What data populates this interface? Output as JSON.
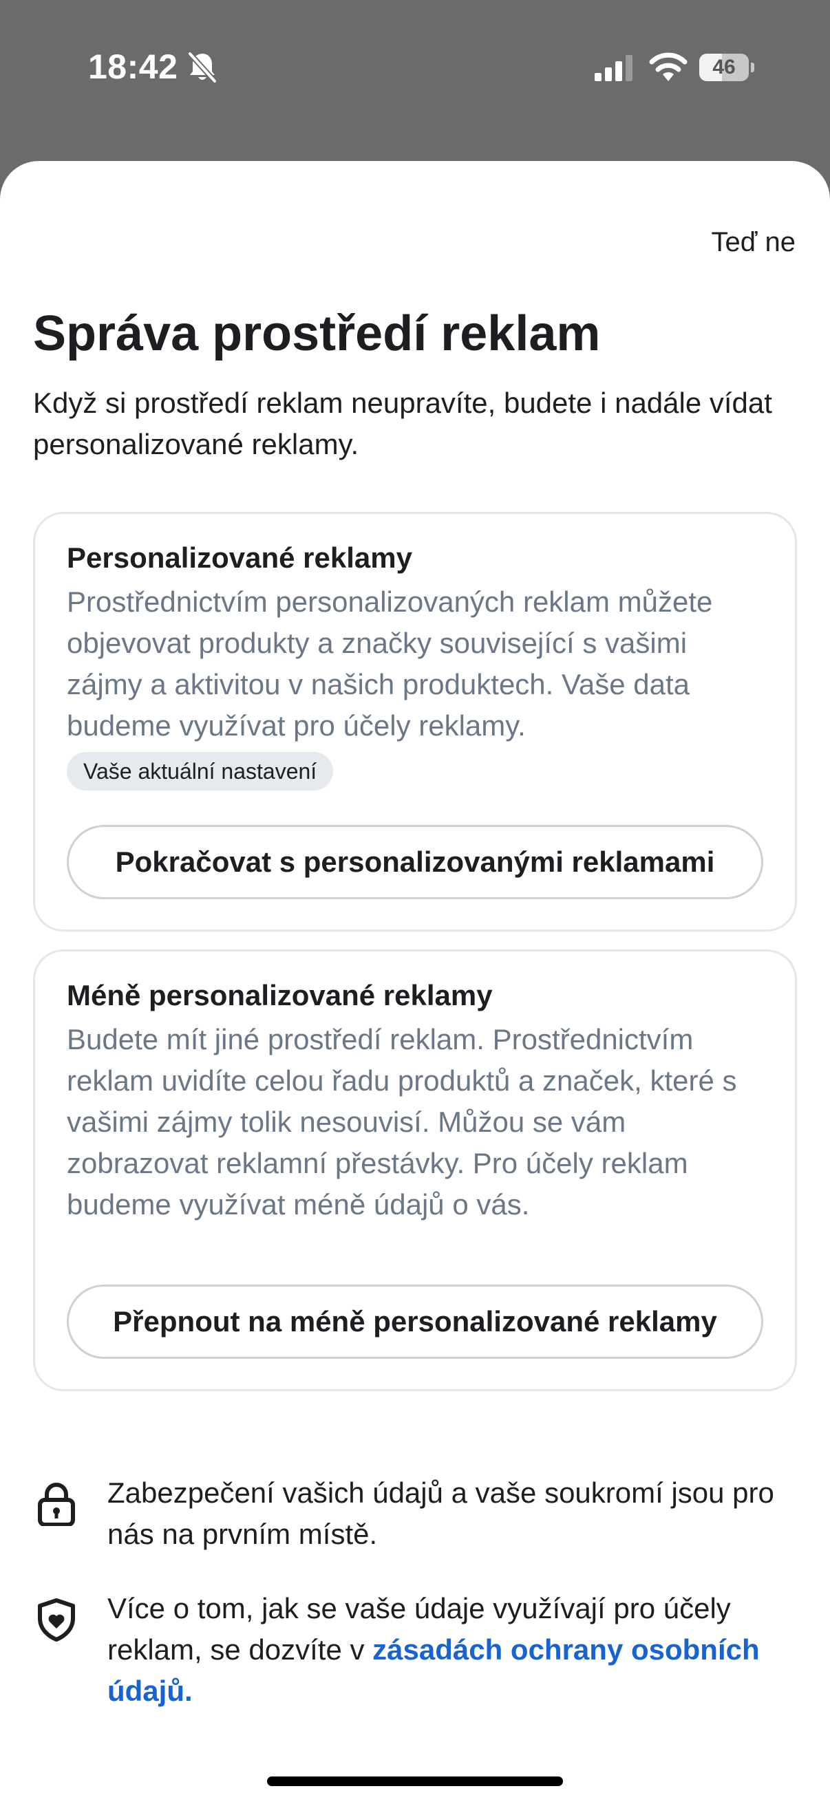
{
  "status_bar": {
    "time": "18:42",
    "battery_level": "46",
    "battery_fraction": 0.46,
    "icons": [
      "bell-slash-icon",
      "signal-icon",
      "wifi-icon",
      "battery-icon"
    ]
  },
  "header": {
    "not_now_label": "Teď ne"
  },
  "main": {
    "title": "Správa prostředí reklam",
    "subtitle": "Když si prostředí reklam neupravíte, budete i nadále vídat personalizované reklamy."
  },
  "cards": [
    {
      "title": "Personalizované reklamy",
      "description": "Prostřednictvím personalizovaných reklam můžete objevovat produkty a značky související s vašimi zájmy a aktivitou v našich produktech. Vaše data budeme využívat pro účely reklamy.",
      "badge": "Vaše aktuální nastavení",
      "button_label": "Pokračovat s personalizovanými reklamami"
    },
    {
      "title": "Méně personalizované reklamy",
      "description": "Budete mít jiné prostředí reklam. Prostřednictvím reklam uvidíte celou řadu produktů a značek, které s vašimi zájmy tolik nesouvisí. Můžou se vám zobrazovat reklamní přestávky. Pro účely reklam budeme využívat méně údajů o vás.",
      "button_label": "Přepnout na méně personalizované reklamy"
    }
  ],
  "info": {
    "privacy_text": "Zabezpečení vašich údajů a vaše soukromí jsou pro nás na prvním místě.",
    "policy_text": "Více o tom, jak se vaše údaje využívají pro účely reklam, se dozvíte v ",
    "policy_link": "zásadách ochrany osobních údajů.",
    "icons": [
      "lock-icon",
      "shield-icon"
    ]
  },
  "colors": {
    "status_bar_bg": "#6b6b6b",
    "link": "#1763d3",
    "muted_text": "#6b7787",
    "badge_bg": "#e6eaef"
  }
}
